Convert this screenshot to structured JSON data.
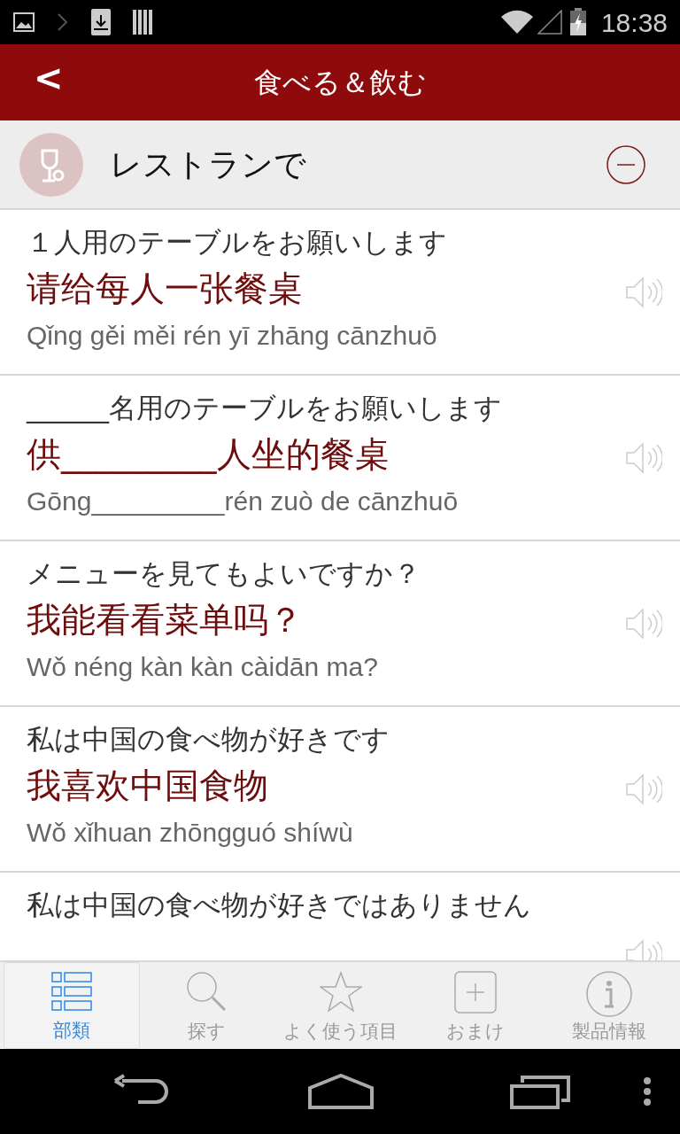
{
  "status_bar": {
    "time": "18:38"
  },
  "header": {
    "back": "<",
    "title": "食べる＆飲む"
  },
  "section": {
    "title": "レストランで",
    "expanded": true
  },
  "phrases": [
    {
      "japanese": "１人用のテーブルをお願いします",
      "chinese": "请给每人一张餐桌",
      "pinyin": "Qǐng gěi měi rén yī zhāng cānzhuō"
    },
    {
      "japanese": "______名用のテーブルをお願いします",
      "chinese": "供_________人坐的餐桌",
      "pinyin": "Gōng_________rén zuò de cānzhuō"
    },
    {
      "japanese": "メニューを見てもよいですか？",
      "chinese": "我能看看菜单吗？",
      "pinyin": "Wǒ néng kàn kàn càidān ma?"
    },
    {
      "japanese": "私は中国の食べ物が好きです",
      "chinese": "我喜欢中国食物",
      "pinyin": "Wǒ xǐhuan zhōngguó shíwù"
    },
    {
      "japanese": "私は中国の食べ物が好きではありません"
    }
  ],
  "tabs": [
    {
      "kind": "categories",
      "label": "部類",
      "selected": true
    },
    {
      "kind": "search",
      "label": "探す",
      "selected": false
    },
    {
      "kind": "favorites",
      "label": "よく使う項目",
      "selected": false
    },
    {
      "kind": "extras",
      "label": "おまけ",
      "selected": false
    },
    {
      "kind": "info",
      "label": "製品情報",
      "selected": false
    }
  ]
}
